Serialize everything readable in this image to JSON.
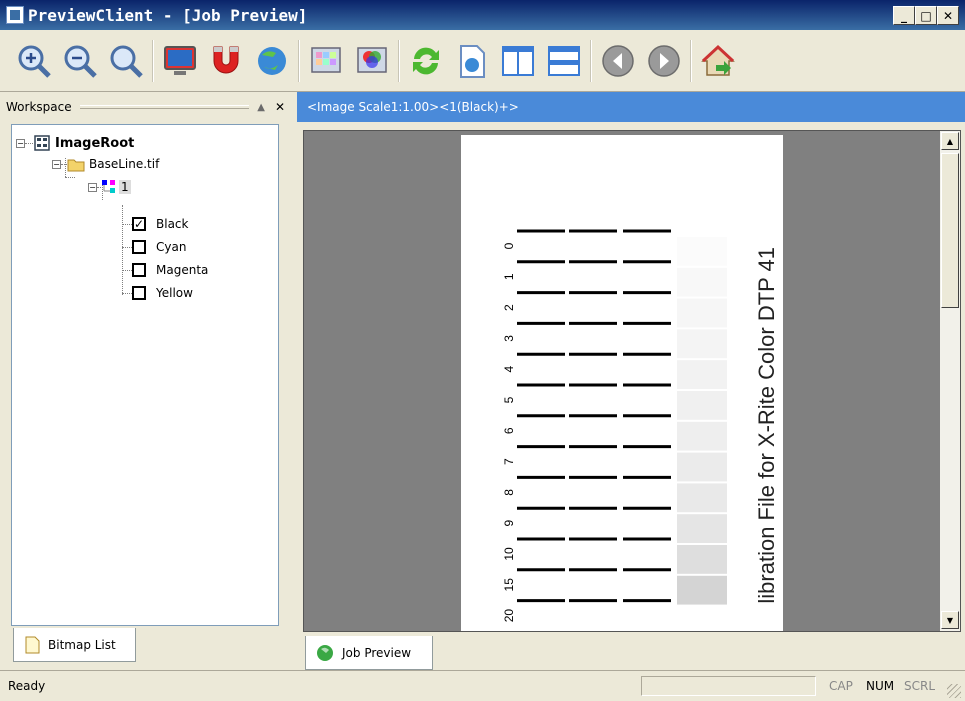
{
  "window": {
    "title": "PreviewClient - [Job Preview]"
  },
  "toolbar": {
    "buttons": [
      {
        "icon": "zoom-in-icon"
      },
      {
        "icon": "zoom-out-icon"
      },
      {
        "icon": "zoom-fit-icon"
      },
      {
        "icon": "monitor-icon"
      },
      {
        "icon": "magnet-icon"
      },
      {
        "icon": "globe-refresh-icon"
      },
      {
        "icon": "color-grid-icon"
      },
      {
        "icon": "color-separation-icon"
      },
      {
        "icon": "refresh-icon"
      },
      {
        "icon": "page-globe-icon"
      },
      {
        "icon": "split-vertical-icon"
      },
      {
        "icon": "split-horizontal-icon"
      },
      {
        "icon": "back-arrow-icon"
      },
      {
        "icon": "forward-arrow-icon"
      },
      {
        "icon": "home-exit-icon"
      }
    ]
  },
  "workspace": {
    "label": "Workspace",
    "tree": {
      "root": "ImageRoot",
      "file": "BaseLine.tif",
      "page": "1",
      "channels": [
        {
          "label": "Black",
          "checked": true
        },
        {
          "label": "Cyan",
          "checked": false
        },
        {
          "label": "Magenta",
          "checked": false
        },
        {
          "label": "Yellow",
          "checked": false
        }
      ]
    },
    "tab": "Bitmap List"
  },
  "preview": {
    "header": "<Image Scale1:1.00><1(Black)+>",
    "tab": "Job Preview",
    "calibration_text": "libration File for X-Rite Color DTP 41",
    "rows": [
      "0",
      "1",
      "2",
      "3",
      "4",
      "5",
      "6",
      "7",
      "8",
      "9",
      "10",
      "15",
      "20"
    ],
    "gray_levels": [
      0.0,
      0.02,
      0.03,
      0.04,
      0.05,
      0.06,
      0.07,
      0.08,
      0.09,
      0.1,
      0.12,
      0.15,
      0.2
    ]
  },
  "status": {
    "text": "Ready",
    "cap": "CAP",
    "num": "NUM",
    "scrl": "SCRL"
  }
}
